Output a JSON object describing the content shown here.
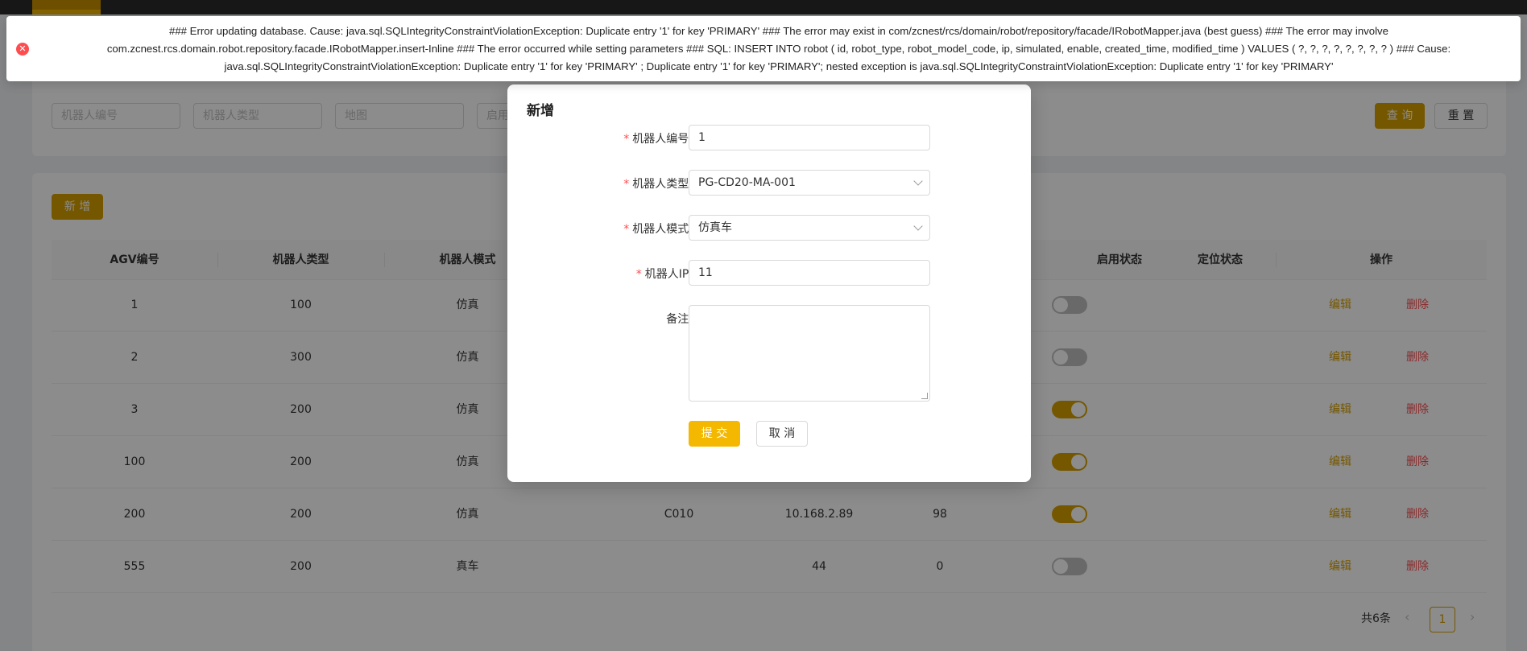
{
  "filters": {
    "robot_no_placeholder": "机器人编号",
    "robot_type_placeholder": "机器人类型",
    "map_placeholder": "地图",
    "enable_placeholder": "启用",
    "query_label": "查 询",
    "reset_label": "重 置"
  },
  "table": {
    "add_label": "新 增",
    "headers": {
      "agv_no": "AGV编号",
      "robot_type": "机器人类型",
      "robot_mode": "机器人模式",
      "enable_status": "启用状态",
      "locate_status": "定位状态",
      "actions": "操作"
    },
    "edit_label": "编辑",
    "delete_label": "删除",
    "rows": [
      {
        "agv_no": "1",
        "type": "100",
        "mode": "仿真",
        "code": "",
        "ip": "",
        "extra": "",
        "enabled": false
      },
      {
        "agv_no": "2",
        "type": "300",
        "mode": "仿真",
        "code": "",
        "ip": "",
        "extra": "",
        "enabled": false
      },
      {
        "agv_no": "3",
        "type": "200",
        "mode": "仿真",
        "code": "",
        "ip": "",
        "extra": "",
        "enabled": true
      },
      {
        "agv_no": "100",
        "type": "200",
        "mode": "仿真",
        "code": "",
        "ip": "",
        "extra": "",
        "enabled": true
      },
      {
        "agv_no": "200",
        "type": "200",
        "mode": "仿真",
        "code": "C010",
        "ip": "10.168.2.89",
        "extra": "98",
        "enabled": true
      },
      {
        "agv_no": "555",
        "type": "200",
        "mode": "真车",
        "code": "",
        "ip": "44",
        "extra": "0",
        "enabled": false
      }
    ]
  },
  "pagination": {
    "total": "共6条",
    "current_page": "1",
    "prev_icon": "‹",
    "next_icon": "›"
  },
  "modal": {
    "title": "新增",
    "required_mark": "*",
    "fields": {
      "robot_no_label": "机器人编号:",
      "robot_no_value": "1",
      "robot_type_label": "机器人类型:",
      "robot_type_value": "PG-CD20-MA-001",
      "robot_mode_label": "机器人模式:",
      "robot_mode_value": "仿真车",
      "robot_ip_label": "机器人IP:",
      "robot_ip_value": "11",
      "remark_label": "备注:"
    },
    "submit_label": "提 交",
    "cancel_label": "取 消"
  },
  "error": {
    "icon": "✕",
    "line1": "### Error updating database. Cause: java.sql.SQLIntegrityConstraintViolationException: Duplicate entry '1' for key 'PRIMARY' ### The error may exist in com/zcnest/rcs/domain/robot/repository/facade/IRobotMapper.java (best guess) ### The error may involve",
    "line2": "com.zcnest.rcs.domain.robot.repository.facade.IRobotMapper.insert-Inline ### The error occurred while setting parameters ### SQL: INSERT INTO robot ( id, robot_type, robot_model_code, ip, simulated, enable, created_time, modified_time ) VALUES ( ?, ?, ?, ?, ?, ?, ?, ? ) ### Cause:",
    "line3": "java.sql.SQLIntegrityConstraintViolationException: Duplicate entry '1' for key 'PRIMARY' ; Duplicate entry '1' for key 'PRIMARY'; nested exception is java.sql.SQLIntegrityConstraintViolationException: Duplicate entry '1' for key 'PRIMARY'"
  },
  "colors": {
    "accent": "#d69e00",
    "submit": "#f5b800",
    "danger": "#ff4d4f"
  }
}
